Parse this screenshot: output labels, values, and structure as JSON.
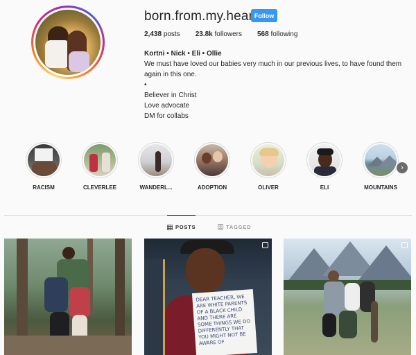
{
  "profile": {
    "username": "born.from.my.heart",
    "follow_label": "Follow",
    "stats": {
      "posts_count": "2,438",
      "posts_label": "posts",
      "followers_count": "23.8k",
      "followers_label": "followers",
      "following_count": "568",
      "following_label": "following"
    },
    "bio": {
      "name": "Kortni • Nick • Eli • Ollie",
      "line1": "We must have loved our babies very much in our previous lives, to have found them again in this one.",
      "bullet": "•",
      "line2": "Believer in Christ",
      "line3": "Love advocate",
      "line4": "DM for collabs"
    }
  },
  "highlights": [
    {
      "label": "RACISM"
    },
    {
      "label": "CLEVERLEE"
    },
    {
      "label": "WANDERL..."
    },
    {
      "label": "ADOPTION"
    },
    {
      "label": "OLIVER"
    },
    {
      "label": "ELI"
    },
    {
      "label": "MOUNTAINS"
    }
  ],
  "tabs": {
    "posts_label": "POSTS",
    "tagged_label": "TAGGED"
  },
  "posts": {
    "sign_text": "DEAR TEACHER, WE ARE WHITE PARENTS OF A BLACK CHILD AND THERE ARE SOME THINGS WE DO DIFFERENTLY THAT YOU MIGHT NOT BE AWARE OF"
  },
  "colors": {
    "accent": "#3897f0",
    "text": "#262626",
    "muted": "#999999",
    "background": "#fafafa"
  }
}
